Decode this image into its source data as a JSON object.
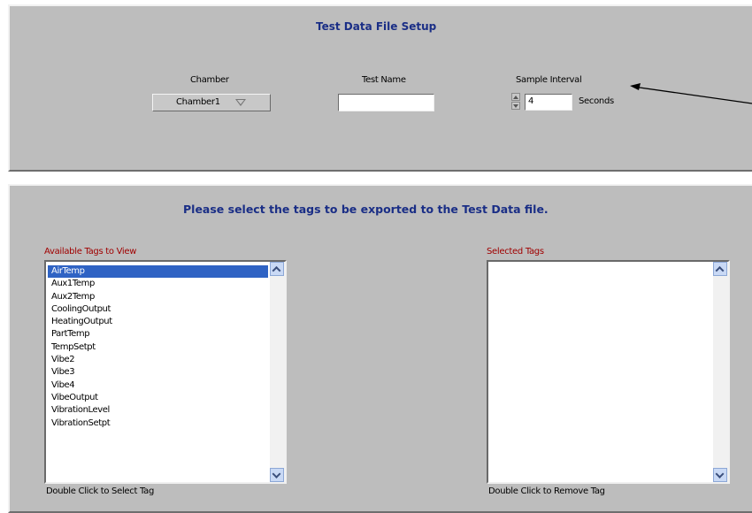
{
  "setup": {
    "title": "Test Data File Setup",
    "chamber_label": "Chamber",
    "chamber_value": "Chamber1",
    "test_name_label": "Test Name",
    "test_name_value": "",
    "interval_label": "Sample Interval",
    "interval_value": "4",
    "interval_unit": "Seconds"
  },
  "tags": {
    "heading": "Please select the tags to be exported to the Test Data file.",
    "available_label": "Available Tags to View",
    "selected_label": "Selected Tags",
    "available_hint": "Double Click to Select Tag",
    "selected_hint": "Double Click to Remove Tag",
    "available_items": [
      "AirTemp",
      "Aux1Temp",
      "Aux2Temp",
      "CoolingOutput",
      "HeatingOutput",
      "PartTemp",
      "TempSetpt",
      "Vibe2",
      "Vibe3",
      "Vibe4",
      "VibeOutput",
      "VibrationLevel",
      "VibrationSetpt"
    ],
    "selected_items": []
  },
  "colors": {
    "panel": "#bdbdbd",
    "title_blue": "#1a2e86",
    "label_red": "#a00000",
    "selection": "#2f63c4"
  }
}
